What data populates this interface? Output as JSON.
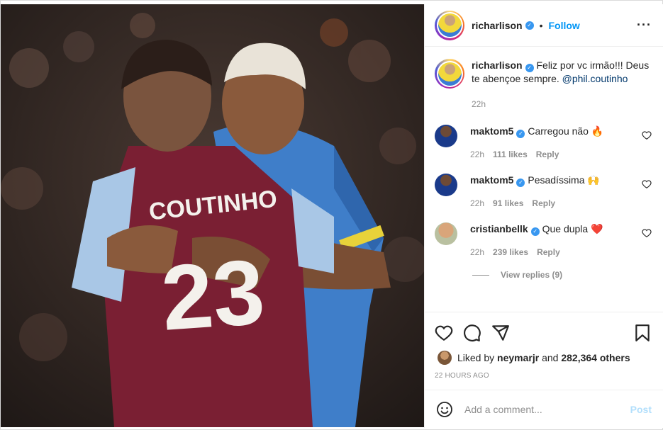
{
  "post": {
    "username": "richarlison",
    "verified": true,
    "follow_label": "Follow",
    "separator": "•"
  },
  "caption": {
    "username": "richarlison",
    "text": "Feliz por vc irmão!!! Deus te abençoe sempre. ",
    "mention": "@phil.coutinho",
    "time": "22h"
  },
  "comments": [
    {
      "username": "maktom5",
      "text": "Carregou não 🔥",
      "time": "22h",
      "likes": "111 likes",
      "reply": "Reply"
    },
    {
      "username": "maktom5",
      "text": "Pesadíssima 🙌",
      "time": "22h",
      "likes": "91 likes",
      "reply": "Reply"
    },
    {
      "username": "cristianbellk",
      "text": "Que dupla ❤️",
      "time": "22h",
      "likes": "239 likes",
      "reply": "Reply"
    }
  ],
  "view_replies": "View replies (9)",
  "likes": {
    "prefix": "Liked by ",
    "user": "neymarjr",
    "middle": " and ",
    "others": "282,364 others"
  },
  "timestamp": "22 HOURS AGO",
  "add_comment": {
    "placeholder": "Add a comment...",
    "post_label": "Post"
  },
  "media": {
    "jersey_name": "COUTINHO",
    "jersey_number": "23"
  },
  "colors": {
    "accent": "#0095f6",
    "verified": "#3897f0",
    "villa_claret": "#7a1f33",
    "everton_blue": "#3f7ec9"
  },
  "icons": [
    "more-icon",
    "verified-icon",
    "heart-icon",
    "comment-icon",
    "share-icon",
    "save-icon",
    "emoji-icon"
  ]
}
